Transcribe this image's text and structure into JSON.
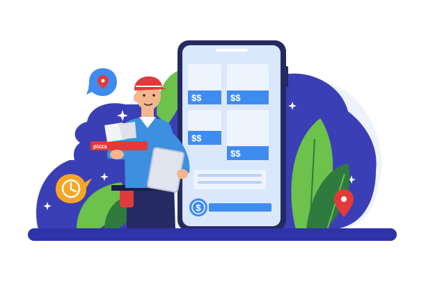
{
  "illustration": {
    "phone": {
      "cards": [
        {
          "price": "$$"
        },
        {
          "price": "$$"
        },
        {
          "price": "$$"
        },
        {
          "price": "$$"
        }
      ],
      "pay_icon_glyph": "$"
    },
    "pizza_box_label": "pizza",
    "icons": [
      "location-pin-icon",
      "clock-icon",
      "dollar-icon",
      "sparkle-icon"
    ],
    "colors": {
      "background_blob": "#3b3fb6",
      "light_blob": "#e9effa",
      "ground": "#2e33a8",
      "phone_body": "#252a62",
      "phone_screen": "#dbe8fb",
      "accent_blue": "#3f8cf0",
      "pin_red": "#e23a3a",
      "clock_orange": "#f6a623",
      "leaf_green": "#6cc24a",
      "leaf_dark": "#2f7a3e",
      "shirt": "#3d8fe0",
      "cap": "#e03a3a"
    }
  }
}
